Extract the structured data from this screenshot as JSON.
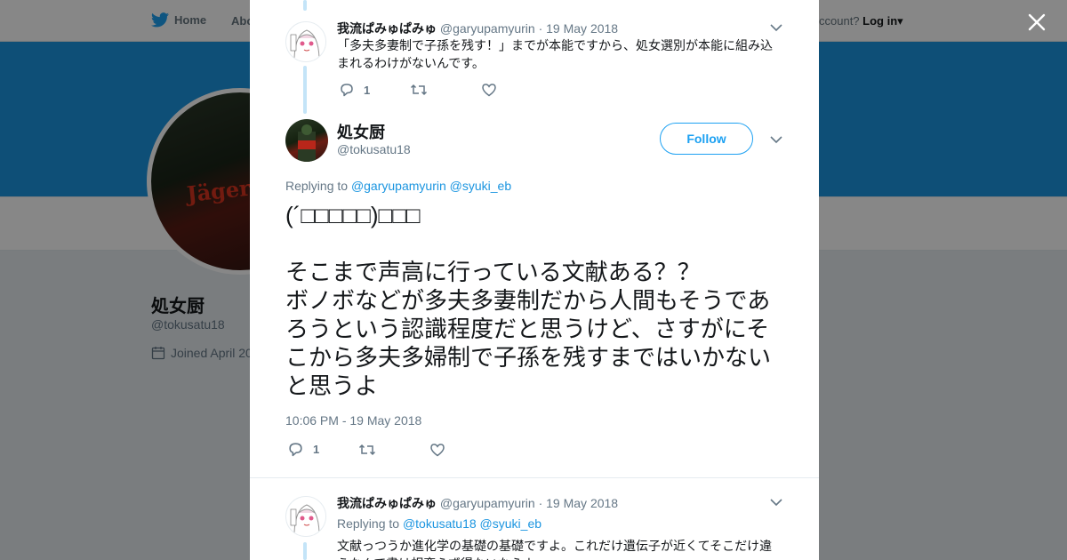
{
  "background": {
    "nav": {
      "home_label": "Home",
      "about_label": "Abo",
      "account_prompt": "ccount?",
      "login_label": "Log in"
    },
    "profile": {
      "name": "処女厨",
      "handle": "@tokusatu18",
      "joined": "Joined April 20",
      "avatar_text": "Jägerm",
      "colors": {
        "banner": "#1b95e0"
      }
    }
  },
  "modal": {
    "close_label": "×",
    "parent_tweet": {
      "name": "我流ぱみゅぱみゅ",
      "handle": "@garyupamyurin",
      "date": "· 19 May 2018",
      "text": "「多夫多妻制で子孫を残す！」までが本能ですから、処女選別が本能に組み込まれるわけがないんです。",
      "reply_count": "1"
    },
    "main_tweet": {
      "name": "処女厨",
      "handle": "@tokusatu18",
      "follow_label": "Follow",
      "replying_to_label": "Replying to",
      "replying_to": [
        "@garyupamyurin",
        "@syuki_eb"
      ],
      "text": "(´□□□□□)□□□\n\nそこまで声高に行っている文献ある？？\nボノボなどが多夫多妻制だから人間もそうであろうという認識程度だと思うけど、さすがにそこから多夫多婦制で子孫を残すまではいかないと思うよ",
      "timestamp": "10:06 PM - 19 May 2018",
      "reply_count": "1"
    },
    "reply_tweet": {
      "name": "我流ぱみゅぱみゅ",
      "handle": "@garyupamyurin",
      "date": "· 19 May 2018",
      "replying_to_label": "Replying to",
      "replying_to": [
        "@tokusatu18",
        "@syuki_eb"
      ],
      "text": "文献っつうか進化学の基礎の基礎ですよ。これだけ遺伝子が近くてそこだけ違うなんて書は相変らず得ないならよ"
    },
    "icons": [
      "reply-icon",
      "retweet-icon",
      "like-icon",
      "caret-down-icon",
      "close-icon",
      "twitter-bird-icon",
      "calendar-icon"
    ]
  }
}
